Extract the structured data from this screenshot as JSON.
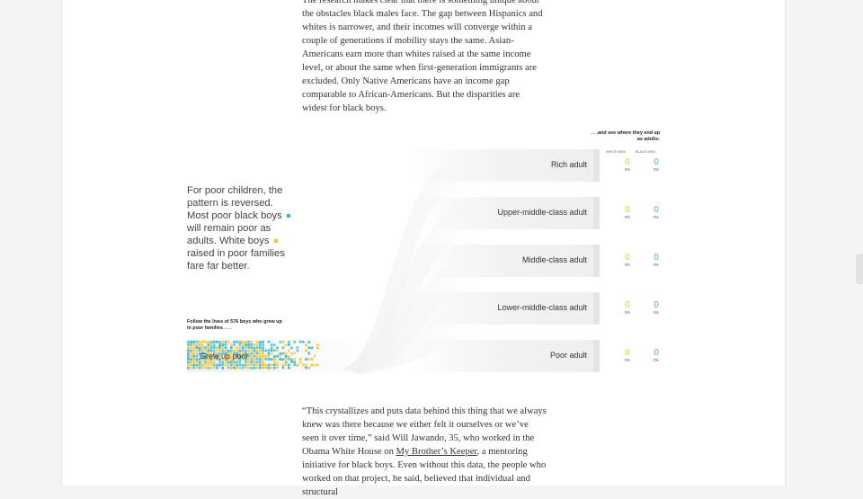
{
  "article": {
    "paragraph_top": "The research makes clear that there is something unique about the obstacles black males face. The gap between Hispanics and whites is narrower, and their incomes will converge within a couple of generations if mobility stays the same. Asian-Americans earn more than whites raised at the same income level, or about the same when first-generation immigrants are excluded. Only Native Americans have an income gap comparable to African-Americans. But the disparities are widest for black boys.",
    "paragraph_bottom": {
      "before_link": "“This crystallizes and puts data behind this thing that we always knew was there because we either felt it ourselves or we’ve seen it over time,” said Will Jawando, 35, who worked in the Obama White House on ",
      "link_text": "My Brother’s Keeper",
      "after_link": ", a mentoring initiative for black boys. Even without this data, the people who worked on that project, he said, believed that individual and structural"
    }
  },
  "graphic": {
    "caption_part1": "For poor children, the pattern is reversed. Most poor black boys",
    "caption_part2": "will remain poor as adults. White boys",
    "caption_part3": "raised in poor families fare far better.",
    "follow_prefix": "Follow the lives of",
    "follow_count": "576",
    "follow_suffix": "boys who grew up in poor families . . .",
    "start_label": "Grew up poor",
    "then_see": ". . .and see where they end up as adults:",
    "col_white": "WHITE MEN",
    "col_black": "BLACK MEN",
    "outcomes": [
      {
        "label": "Rich adult",
        "white": "0",
        "white_pct": "0%",
        "black": "0",
        "black_pct": "0%"
      },
      {
        "label": "Upper-middle-class adult",
        "white": "0",
        "white_pct": "0%",
        "black": "0",
        "black_pct": "0%"
      },
      {
        "label": "Middle-class adult",
        "white": "0",
        "white_pct": "0%",
        "black": "0",
        "black_pct": "0%"
      },
      {
        "label": "Lower-middle-class adult",
        "white": "0",
        "white_pct": "0%",
        "black": "0",
        "black_pct": "0%"
      },
      {
        "label": "Poor adult",
        "white": "0",
        "white_pct": "0%",
        "black": "0",
        "black_pct": "0%"
      }
    ],
    "colors": {
      "white_men": "#f4c531",
      "black_men": "#33b6d6"
    }
  }
}
